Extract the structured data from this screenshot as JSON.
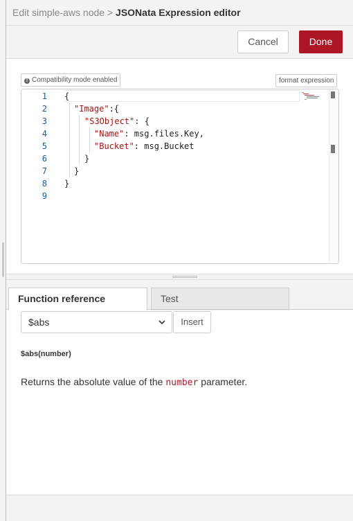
{
  "header": {
    "breadcrumb": "Edit simple-aws node",
    "separator": ">",
    "title": "JSONata Expression editor"
  },
  "toolbar": {
    "cancel_label": "Cancel",
    "done_label": "Done",
    "accent_color": "#ad1625"
  },
  "editor": {
    "compat_label": "Compatibility mode enabled",
    "format_label": "format expression",
    "line_numbers": [
      "1",
      "2",
      "3",
      "4",
      "5",
      "6",
      "7",
      "8",
      "9"
    ],
    "lines": [
      {
        "text": "{"
      },
      {
        "key": "\"Image\"",
        "rest": ":{"
      },
      {
        "key": "\"S3Object\"",
        "rest": ": {"
      },
      {
        "key": "\"Name\"",
        "rest": ": msg.files.Key,"
      },
      {
        "key": "\"Bucket\"",
        "rest": ": msg.Bucket"
      },
      {
        "text": "}"
      },
      {
        "text": "}"
      },
      {
        "text": "}"
      },
      {
        "text": ""
      }
    ]
  },
  "tabs": {
    "function_reference": "Function reference",
    "test": "Test"
  },
  "function_ref": {
    "selected_function": "$abs",
    "insert_label": "Insert",
    "signature": "$abs(number)",
    "desc_before": "Returns the absolute value of the ",
    "desc_code": "number",
    "desc_after": " parameter."
  },
  "icons": {
    "info": "info-icon",
    "dropdown": "chevron-down-icon"
  }
}
